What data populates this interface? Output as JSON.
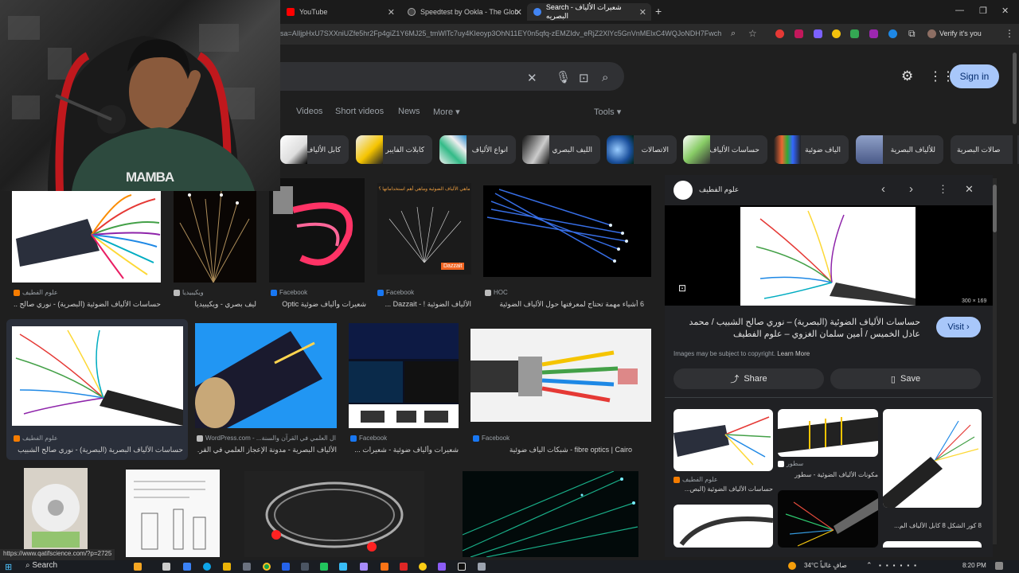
{
  "browser": {
    "tabs": [
      {
        "title": "YouTube",
        "color": "#ff0000"
      },
      {
        "title": "Speedtest by Ookla - The Glob",
        "color": "#444"
      },
      {
        "title": "Search - شعيرات الألياف البصريه",
        "color": "#4285f4"
      }
    ],
    "new_tab": "+",
    "url": "&sa=AIljpHxU7SXXniUZfe5hr2Fp4giZ1Y6MJ25_tmWlTc7uy4KIeoyp3OhN11EY0n5qfq-zEMZIdv_eRjZ2XlYc5GnVnMElxC4WQJoNDH7Fwch...",
    "verify": "Verify it's you"
  },
  "search": {
    "sign_in": "Sign in",
    "nav": [
      "Videos",
      "Short videos",
      "News",
      "More ▾",
      "Tools ▾"
    ]
  },
  "chips": [
    "كابل الألياف",
    "كابلات الفايبر",
    "انواع الألياف",
    "الليف البصري",
    "الاتصالات",
    "حساسات الألياف",
    "الياف ضوئية",
    "للألياف البصرية",
    "صالات البصرية"
  ],
  "streamer": {
    "shirt_text": "MAMBA"
  },
  "results": {
    "row1": [
      {
        "source": "علوم الفطيف",
        "caption": "حساسات الألياف الضوئية (البصرية) - نوري صالح ..."
      },
      {
        "source": "ويكيبيديا",
        "caption": "ليف بصري - ويكيبيديا"
      },
      {
        "source": "Facebook",
        "caption": "شعيرات وألياف ضوئية Optic"
      },
      {
        "source": "Facebook",
        "caption": "الألياف الضوئية ! - Dazzait ..."
      },
      {
        "source": "HOC",
        "caption": "6 أشياء مهمة تحتاج لمعرفتها حول الألياف الضوئية"
      }
    ],
    "row2": [
      {
        "source": "علوم الفطيف",
        "caption": "حساسات الألياف البصرية (البصرية) - نوري صالح الشبيب"
      },
      {
        "source": "WordPress.com - ...ال العلمي في القرآن والسنة",
        "caption": "الألياف البصرية - مدونة الإعجاز العلمي في القر..."
      },
      {
        "source": "Facebook",
        "caption": "شعيرات وألياف ضوئية - شعيرات ..."
      },
      {
        "source": "Facebook",
        "caption": "fibre optics | Cairo - شبكات الياف ضوئية"
      }
    ],
    "dazzait_badge": "Dazzait",
    "dazzait_title": "ماهي الألياف الضوئية وماهي أهم استخداماتها ؟"
  },
  "panel": {
    "site": "علوم الفطيف",
    "dimensions": "300 × 169",
    "title": "حساسات الألياف الضوئية (البصرية) – نوري صالح الشبيب / محمد عادل الخميس / أمين سلمان الغزوي – علوم الفطيف",
    "visit": "Visit",
    "copyright": "Images may be subject to copyright.",
    "learn_more": "Learn More",
    "share": "Share",
    "save": "Save",
    "related": [
      {
        "source": "علوم الفطيف",
        "caption": "حساسات الألياف الضوئية (البص..."
      },
      {
        "source": "سطور",
        "caption": "مكونات الألياف الضوئية - سطور"
      },
      {
        "source": "",
        "caption": "8 كور الشكل 8 كابل الألياف الم..."
      }
    ]
  },
  "status_url": "https://www.qatifscience.com/?p=2725",
  "taskbar": {
    "search": "Search",
    "weather": "34°C صافٍ غالباً",
    "time": "8:20 PM"
  }
}
